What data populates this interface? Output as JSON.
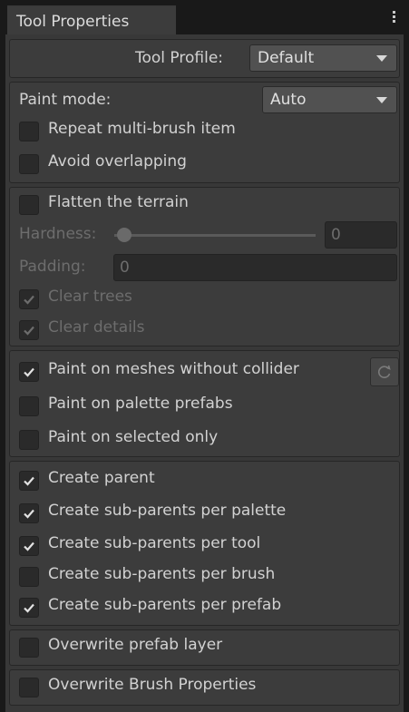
{
  "tab": {
    "title": "Tool Properties",
    "menu_icon": "kebab-menu-icon"
  },
  "tool_profile": {
    "label": "Tool Profile:",
    "value": "Default"
  },
  "paint": {
    "mode_label": "Paint mode:",
    "mode_value": "Auto",
    "repeat_label": "Repeat multi-brush item",
    "repeat_checked": false,
    "avoid_label": "Avoid overlapping",
    "avoid_checked": false
  },
  "terrain": {
    "flatten_label": "Flatten the terrain",
    "flatten_checked": false,
    "hardness_label": "Hardness:",
    "hardness_value": "0",
    "padding_label": "Padding:",
    "padding_value": "0",
    "clear_trees_label": "Clear trees",
    "clear_trees_checked": true,
    "clear_details_label": "Clear details",
    "clear_details_checked": true
  },
  "meshes": {
    "no_collider_label": "Paint on meshes without collider",
    "no_collider_checked": true,
    "palette_prefabs_label": "Paint on palette prefabs",
    "palette_prefabs_checked": false,
    "selected_only_label": "Paint on selected only",
    "selected_only_checked": false,
    "refresh_icon": "refresh-icon"
  },
  "parents": {
    "create_parent": "Create parent",
    "per_palette": "Create sub-parents per palette",
    "per_tool": "Create sub-parents per tool",
    "per_brush": "Create sub-parents per brush",
    "per_prefab": "Create sub-parents per prefab",
    "checked": [
      true,
      true,
      true,
      false,
      true
    ]
  },
  "overwrite_layer": {
    "label": "Overwrite prefab layer",
    "checked": false
  },
  "overwrite_brush": {
    "label": "Overwrite Brush Properties",
    "checked": false
  }
}
